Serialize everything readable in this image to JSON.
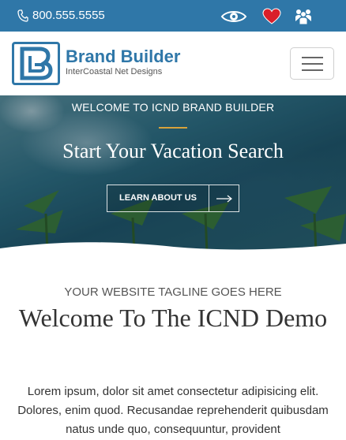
{
  "topbar": {
    "phone": "800.555.5555",
    "colors": {
      "bar": "#2f77a8",
      "heart": "#d91f2a"
    },
    "icons": [
      "phone-icon",
      "eye-icon",
      "heart-icon",
      "users-icon"
    ]
  },
  "header": {
    "brand_name": "Brand Builder",
    "brand_sub": "InterCoastal Net Designs",
    "logo_letter": "B",
    "menu_icon": "hamburger-menu-icon"
  },
  "hero": {
    "kicker": "WELCOME TO ICND BRAND BUILDER",
    "title": "Start Your Vacation Search",
    "button_label": "LEARN ABOUT US",
    "accent": "#d8a23b"
  },
  "content": {
    "tagline": "YOUR WEBSITE TAGLINE GOES HERE",
    "welcome": "Welcome To The ICND Demo",
    "paragraph": "Lorem ipsum, dolor sit amet consectetur adipisicing elit. Dolores, enim quod. Recusandae reprehenderit quibusdam natus unde quo, consequuntur, provident"
  }
}
